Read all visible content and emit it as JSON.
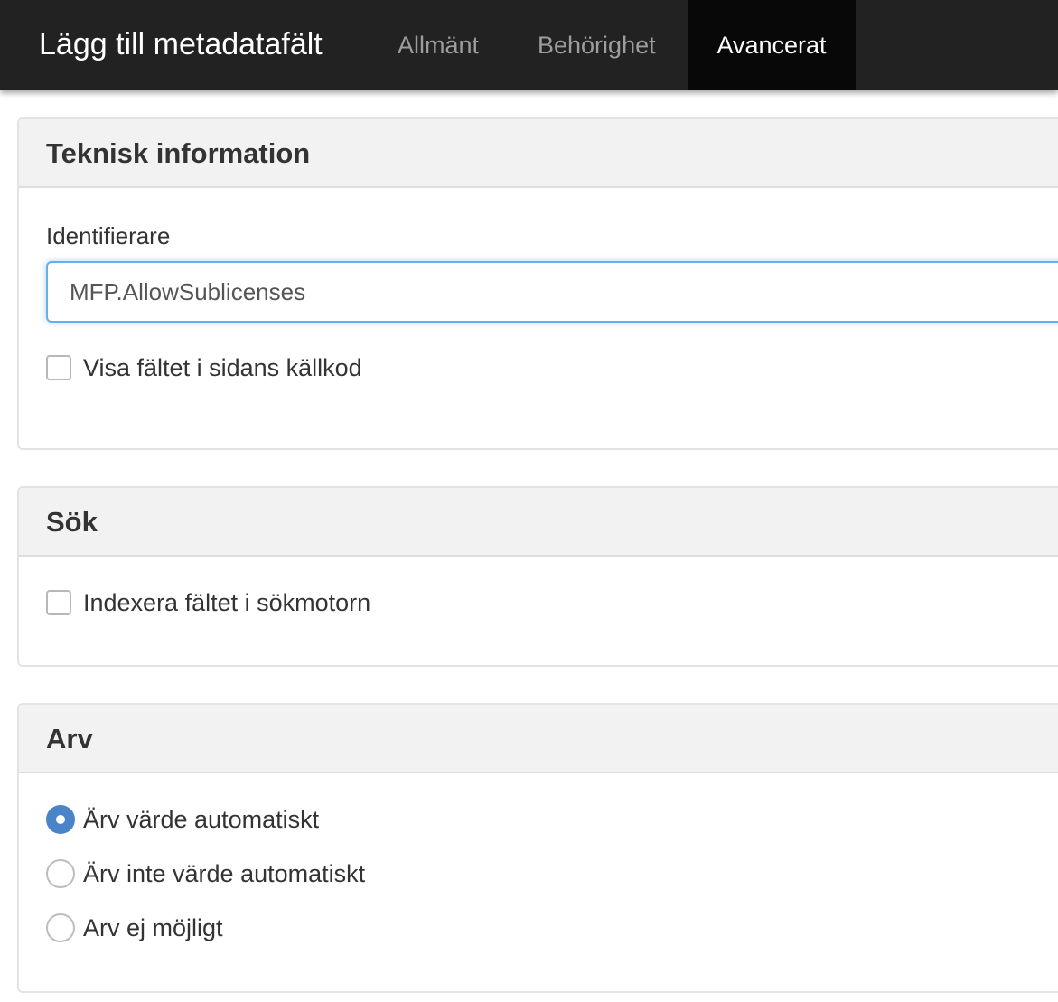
{
  "header": {
    "title": "Lägg till metadatafält",
    "tabs": [
      {
        "label": "Allmänt",
        "active": false
      },
      {
        "label": "Behörighet",
        "active": false
      },
      {
        "label": "Avancerat",
        "active": true
      }
    ]
  },
  "technical": {
    "title": "Teknisk information",
    "identifier_label": "Identifierare",
    "identifier_value": "MFP.AllowSublicenses",
    "show_in_source_label": "Visa fältet i sidans källkod",
    "show_in_source_checked": false
  },
  "search": {
    "title": "Sök",
    "index_label": "Indexera fältet i sökmotorn",
    "index_checked": false
  },
  "inheritance": {
    "title": "Arv",
    "options": [
      {
        "label": "Ärv värde automatiskt",
        "selected": true
      },
      {
        "label": "Ärv inte värde automatiskt",
        "selected": false
      },
      {
        "label": "Arv ej möjligt",
        "selected": false
      }
    ]
  },
  "colors": {
    "topbar": "#222222",
    "active_tab": "#080808",
    "focus_border": "#66afe9",
    "radio_checked": "#4a84c8"
  }
}
